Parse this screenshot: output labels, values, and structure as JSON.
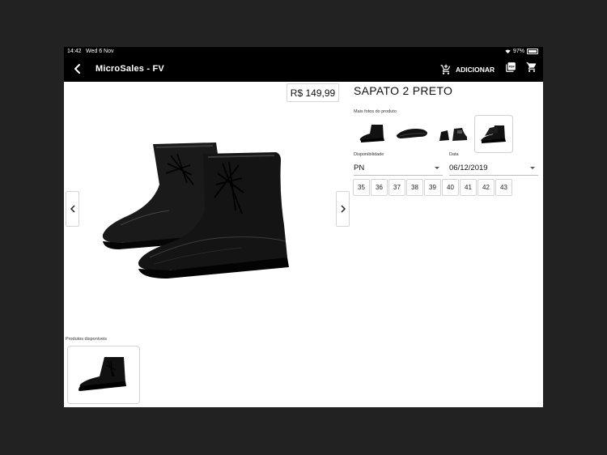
{
  "status_bar": {
    "time": "14:42",
    "date": "Wed 6 Nov",
    "battery": "97%"
  },
  "app_bar": {
    "title": "MicroSales - FV",
    "add_label": "ADICIONAR"
  },
  "product": {
    "price": "R$ 149,99",
    "name": "SAPATO 2 PRETO",
    "more_photos_label": "Mais fotos do produto",
    "availability_label": "Disponibilidade",
    "availability_value": "PN",
    "date_label": "Data",
    "date_value": "06/12/2019",
    "sizes": [
      "35",
      "36",
      "37",
      "38",
      "39",
      "40",
      "41",
      "42",
      "43"
    ],
    "available_products_label": "Produtos disponíveis"
  },
  "icons": {
    "back": "back-arrow-icon",
    "add_cart": "add-shopping-cart-icon",
    "pdf": "pdf-icon",
    "cart": "shopping-cart-icon",
    "prev": "chevron-left-icon",
    "next": "chevron-right-icon"
  },
  "colors": {
    "app_bar": "#000000",
    "background": "#222222",
    "panel": "#ffffff"
  }
}
